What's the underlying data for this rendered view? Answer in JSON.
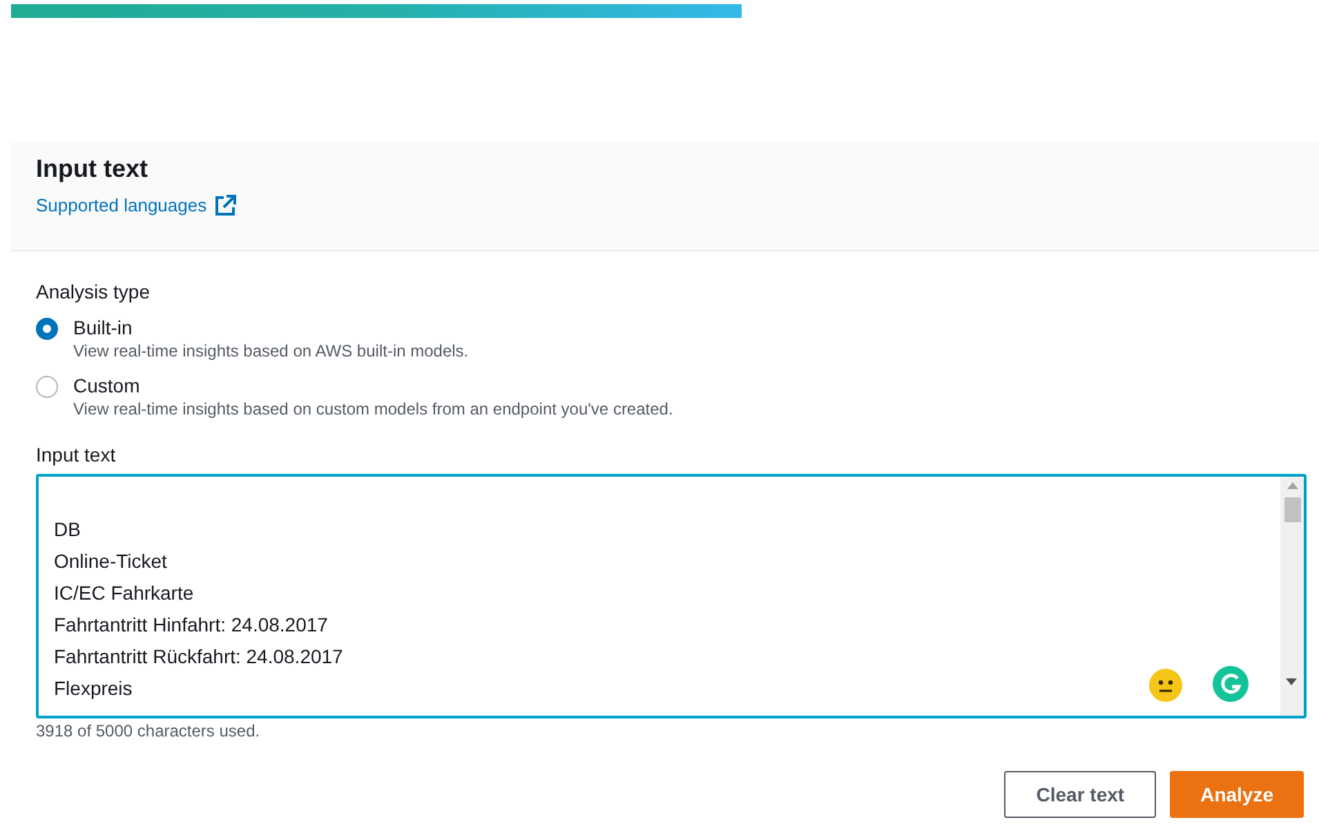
{
  "header": {
    "title": "Input text",
    "link": "Supported languages"
  },
  "analysis_type": {
    "label": "Analysis type",
    "options": [
      {
        "label": "Built-in",
        "description": "View real-time insights based on AWS built-in models.",
        "selected": true
      },
      {
        "label": "Custom",
        "description": "View real-time insights based on custom models from an endpoint you've created.",
        "selected": false
      }
    ]
  },
  "input": {
    "label": "Input text",
    "lines": [
      "DB",
      "Online-Ticket",
      "IC/EC Fahrkarte",
      "Fahrtantritt Hinfahrt: 24.08.2017",
      "Fahrtantritt Rückfahrt: 24.08.2017",
      "Flexpreis"
    ],
    "counter": "3918 of 5000 characters used."
  },
  "buttons": [
    {
      "label": "Clear text",
      "kind": "secondary"
    },
    {
      "label": "Analyze",
      "kind": "primary"
    }
  ]
}
